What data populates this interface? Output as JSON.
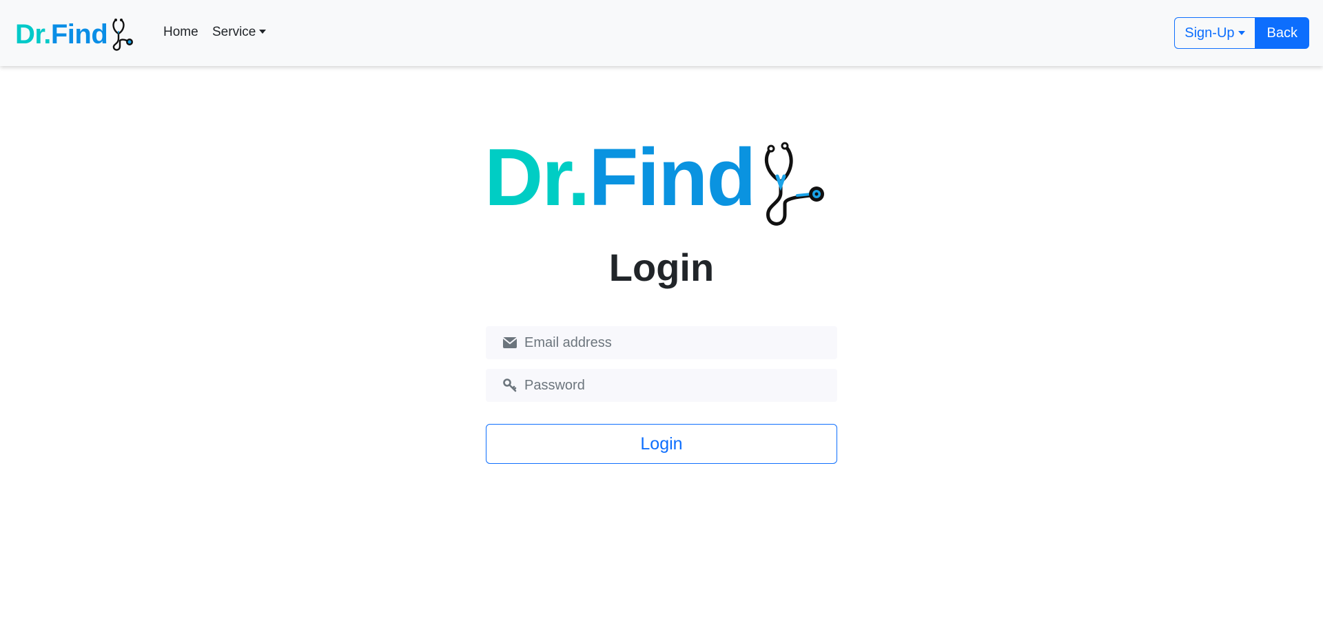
{
  "navbar": {
    "brand": {
      "part1": "Dr.",
      "part2": "Find"
    },
    "links": {
      "home": "Home",
      "service": "Service"
    },
    "signup_label": "Sign-Up",
    "back_label": "Back"
  },
  "main": {
    "logo": {
      "part1": "Dr.",
      "part2": "Find"
    },
    "title": "Login",
    "email": {
      "placeholder": "Email address",
      "icon": "envelope-icon"
    },
    "password": {
      "placeholder": "Password",
      "icon": "key-icon"
    },
    "login_label": "Login"
  },
  "colors": {
    "logo_teal": "#00cdc4",
    "logo_blue": "#0a8ee6",
    "primary": "#0d6efd",
    "navbar_bg": "#f8f9fa",
    "input_bg": "#f8f8fc"
  }
}
